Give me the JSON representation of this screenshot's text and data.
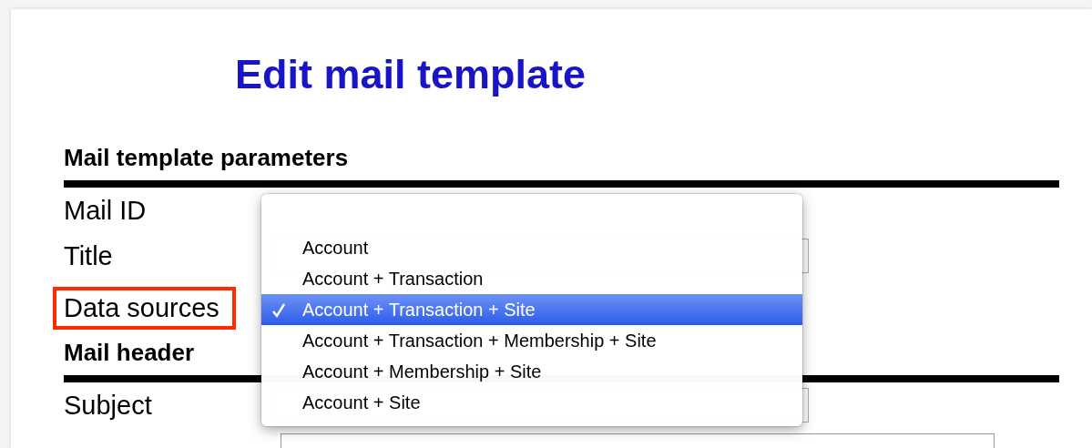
{
  "heading": "Edit mail template",
  "sections": [
    {
      "title": "Mail template parameters",
      "fields": [
        {
          "label": "Mail ID",
          "kind": "text",
          "highlighted": false
        },
        {
          "label": "Title",
          "kind": "input",
          "highlighted": false
        },
        {
          "label": "Data sources",
          "kind": "select",
          "highlighted": true
        }
      ]
    },
    {
      "title": "Mail header",
      "fields": [
        {
          "label": "Subject",
          "kind": "input",
          "highlighted": false
        },
        {
          "kind": "textarea",
          "highlighted": false
        }
      ]
    }
  ],
  "dropdown": {
    "options": [
      {
        "label": "Account",
        "selected": false
      },
      {
        "label": "Account + Transaction",
        "selected": false
      },
      {
        "label": "Account + Transaction + Site",
        "selected": true
      },
      {
        "label": "Account + Transaction + Membership + Site",
        "selected": false
      },
      {
        "label": "Account + Membership + Site",
        "selected": false
      },
      {
        "label": "Account + Site",
        "selected": false
      }
    ]
  }
}
